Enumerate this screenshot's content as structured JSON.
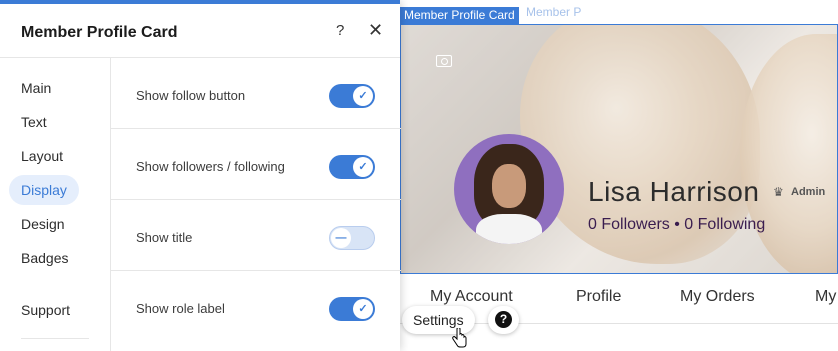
{
  "panel": {
    "title": "Member Profile Card",
    "help_glyph": "?",
    "close_glyph": "✕",
    "nav": [
      {
        "label": "Main",
        "active": false
      },
      {
        "label": "Text",
        "active": false
      },
      {
        "label": "Layout",
        "active": false
      },
      {
        "label": "Display",
        "active": true
      },
      {
        "label": "Design",
        "active": false
      },
      {
        "label": "Badges",
        "active": false
      },
      {
        "label": "Support",
        "active": false
      }
    ],
    "options": [
      {
        "label": "Show follow button",
        "enabled": true
      },
      {
        "label": "Show followers / following",
        "enabled": true
      },
      {
        "label": "Show title",
        "enabled": false
      },
      {
        "label": "Show role label",
        "enabled": true
      }
    ]
  },
  "preview": {
    "component_label": "Member Profile Card",
    "ghost_label": "Member P",
    "member_name": "Lisa Harrison",
    "role_label": "Admin",
    "follow_stats": "0 Followers • 0 Following",
    "tabs": [
      "My Account",
      "Profile",
      "My Orders",
      "My"
    ],
    "active_tab": "Profile",
    "settings_button": "Settings",
    "help_button": "?"
  },
  "colors": {
    "accent": "#3b7bd6",
    "avatar_bg": "#8f6fbf",
    "stats_text": "#3a1d4f"
  }
}
